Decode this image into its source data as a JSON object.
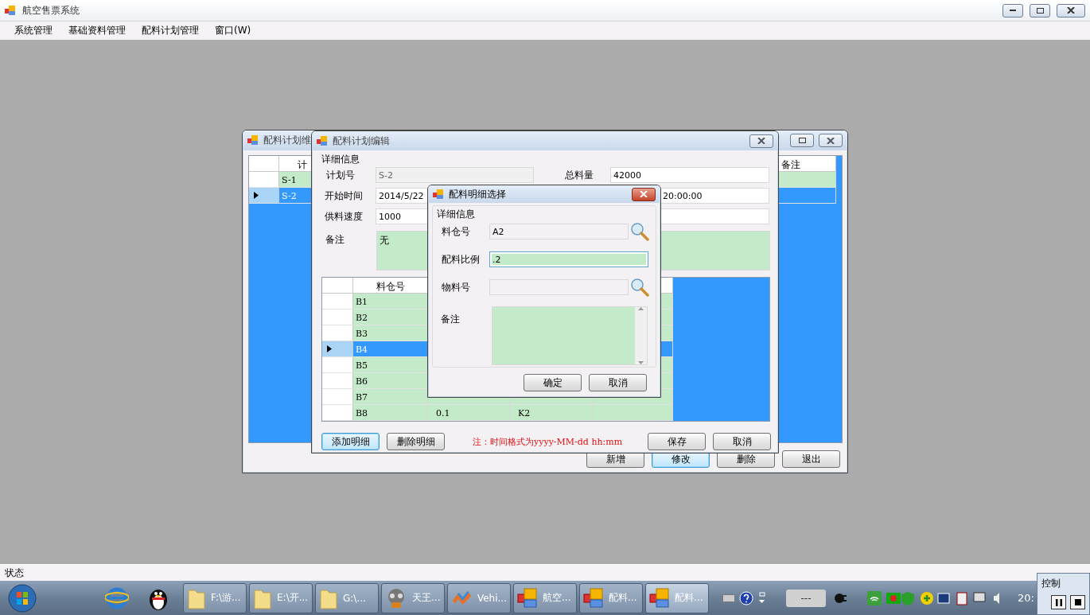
{
  "app": {
    "title": "航空售票系统",
    "menu": [
      "系统管理",
      "基础资料管理",
      "配料计划管理",
      "窗口(W)"
    ]
  },
  "back_window": {
    "title": "配料计划维",
    "grid": {
      "columns": [
        "计",
        "备注"
      ],
      "rows": [
        {
          "cells": [
            "S-1",
            ""
          ],
          "selected": false
        },
        {
          "cells": [
            "S-2",
            ""
          ],
          "selected": true
        }
      ]
    },
    "buttons": [
      {
        "label": "新增",
        "focused": false
      },
      {
        "label": "修改",
        "focused": true
      },
      {
        "label": "删除",
        "focused": false
      },
      {
        "label": "退出",
        "focused": false
      }
    ]
  },
  "edit_window": {
    "title": "配料计划编辑",
    "group_title": "详细信息",
    "fields": [
      {
        "label": "计划号",
        "value": "S-2",
        "disabled": true,
        "label2": "总料量",
        "value2": "42000"
      },
      {
        "label": "开始时间",
        "value": "2014/5/22",
        "disabled": false,
        "value2": "20:00:00"
      },
      {
        "label": "供料速度",
        "value": "1000",
        "disabled": false
      }
    ],
    "remark": {
      "label": "备注",
      "value": "无"
    },
    "grid": {
      "columns": [
        "料仓号"
      ],
      "rows": [
        {
          "cells": [
            "B1",
            "",
            ""
          ],
          "selected": false
        },
        {
          "cells": [
            "B2",
            "",
            ""
          ],
          "selected": false
        },
        {
          "cells": [
            "B3",
            "",
            ""
          ],
          "selected": false
        },
        {
          "cells": [
            "B4",
            "",
            ""
          ],
          "selected": true
        },
        {
          "cells": [
            "B5",
            "",
            ""
          ],
          "selected": false
        },
        {
          "cells": [
            "B6",
            "",
            ""
          ],
          "selected": false
        },
        {
          "cells": [
            "B7",
            "",
            ""
          ],
          "selected": false
        },
        {
          "cells": [
            "B8",
            "0.1",
            "K2"
          ],
          "selected": false
        }
      ]
    },
    "buttons": [
      {
        "label": "添加明细",
        "focused": true
      },
      {
        "label": "删除明细",
        "focused": false
      }
    ],
    "note": "注：时间格式为yyyy-MM-dd hh:mm",
    "actions": [
      {
        "label": "保存",
        "focused": false
      },
      {
        "label": "取消",
        "focused": false
      }
    ]
  },
  "dialog": {
    "title": "配料明细选择",
    "group_title": "详细信息",
    "fields": [
      {
        "label": "料仓号",
        "value": "A2",
        "kind": "lookup",
        "focused": false
      },
      {
        "label": "配料比例",
        "value": ".2",
        "kind": "text",
        "focused": true
      },
      {
        "label": "物料号",
        "kind": "lookup",
        "focused": false
      }
    ],
    "remark": {
      "label": "备注"
    },
    "buttons": [
      {
        "label": "确定",
        "focused": false
      },
      {
        "label": "取消",
        "focused": false
      }
    ]
  },
  "status_bar": "状态",
  "taskbar": {
    "tasks": [
      {
        "label": "F:\\游...",
        "kind": "folder",
        "active": false
      },
      {
        "label": "E:\\开...",
        "kind": "folder",
        "active": false
      },
      {
        "label": "G:\\...",
        "kind": "folder",
        "active": false
      },
      {
        "label": "天王...",
        "kind": "mask",
        "active": false
      },
      {
        "label": "Vehi...",
        "kind": "ribbon",
        "active": false
      },
      {
        "label": "航空...",
        "kind": "app",
        "active": false
      },
      {
        "label": "配料...",
        "kind": "app",
        "active": false
      },
      {
        "label": "配料...",
        "kind": "app",
        "active": true
      }
    ],
    "battery": "---",
    "clock": "20:"
  },
  "recorder_panel": {
    "title": "控制"
  }
}
